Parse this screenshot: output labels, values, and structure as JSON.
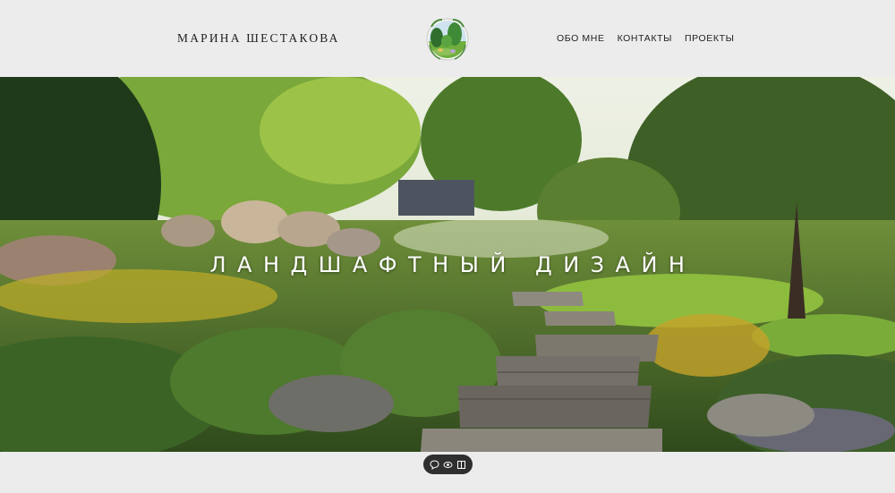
{
  "header": {
    "brand": "МАРИНА ШЕСТАКОВА",
    "logo_icon": "garden-logo-icon",
    "nav": [
      {
        "label": "ОБО МНЕ"
      },
      {
        "label": "КОНТАКТЫ"
      },
      {
        "label": "ПРОЕКТЫ"
      }
    ]
  },
  "hero": {
    "title": "ЛАНДШАФТНЫЙ ДИЗАЙН",
    "image": "garden-landscape-image"
  },
  "toolbar": {
    "icons": [
      "chat-icon",
      "eye-icon",
      "book-icon"
    ]
  },
  "colors": {
    "background": "#ececec",
    "text": "#1e1e1e",
    "pill": "#2f2f2f"
  }
}
